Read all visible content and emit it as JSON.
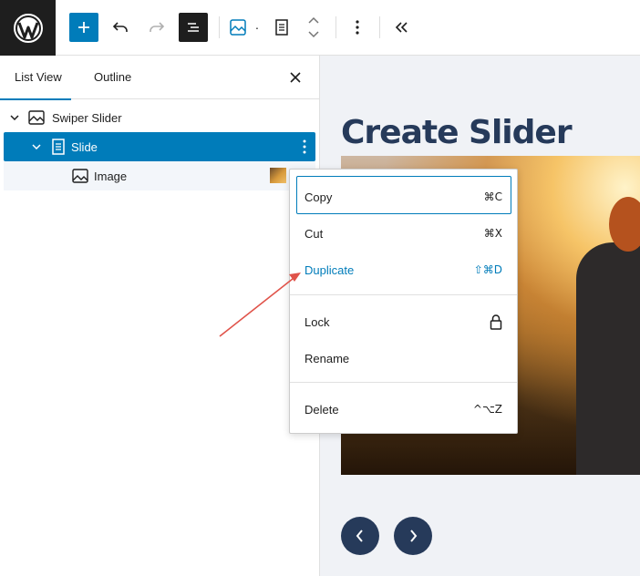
{
  "toolbar": {
    "icons": [
      "wordpress-logo",
      "add-block",
      "undo",
      "redo",
      "document-overview",
      "swiper-block",
      "slide-block",
      "move-arrows",
      "options",
      "collapse"
    ]
  },
  "sidebar": {
    "tabs": [
      {
        "label": "List View"
      },
      {
        "label": "Outline"
      }
    ],
    "active_tab": "List View",
    "rows": [
      {
        "label": "Swiper Slider",
        "level": 1,
        "expanded": true
      },
      {
        "label": "Slide",
        "level": 2,
        "expanded": true,
        "selected": true
      },
      {
        "label": "Image",
        "level": 3
      }
    ]
  },
  "canvas": {
    "heading": "Create Slider"
  },
  "context_menu": {
    "items": [
      {
        "label": "Copy",
        "shortcut": "⌘C"
      },
      {
        "label": "Cut",
        "shortcut": "⌘X"
      },
      {
        "label": "Duplicate",
        "shortcut": "⇧⌘D"
      },
      {
        "label": "Lock"
      },
      {
        "label": "Rename"
      },
      {
        "label": "Delete",
        "shortcut": "^⌥Z"
      }
    ]
  },
  "colors": {
    "accent": "#007cba",
    "annotation_arrow": "#e0534a",
    "heading": "#263a5a"
  }
}
